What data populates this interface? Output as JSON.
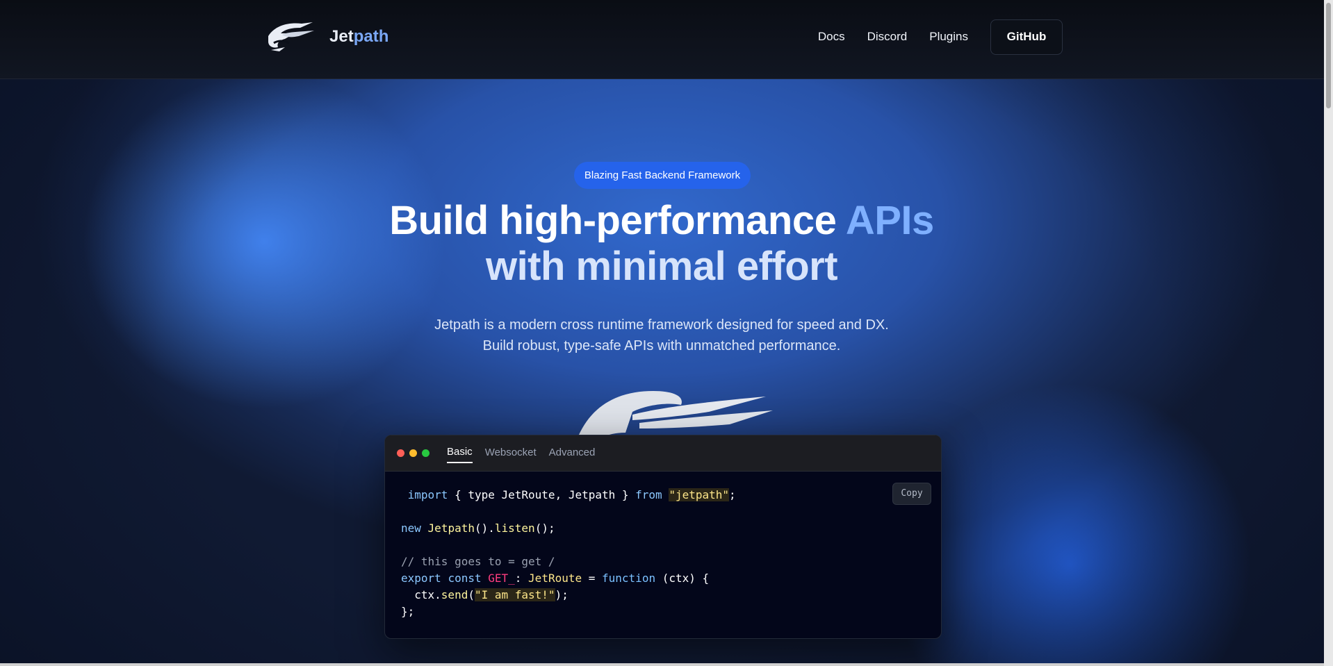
{
  "header": {
    "brand_prefix": "Jet",
    "brand_suffix": "path",
    "logo_icon": "jetpath-bird-logo",
    "nav": [
      {
        "label": "Docs"
      },
      {
        "label": "Discord"
      },
      {
        "label": "Plugins"
      }
    ],
    "github_label": "GitHub"
  },
  "hero": {
    "badge": "Blazing Fast Backend Framework",
    "headline_line1_a": "Build high-performance ",
    "headline_line1_b": "APIs",
    "headline_line2": "with minimal effort",
    "sub_line1": "Jetpath is a modern cross runtime framework designed for speed and DX.",
    "sub_line2": "Build robust, type-safe APIs with unmatched performance."
  },
  "code": {
    "tabs": [
      "Basic",
      "Websocket",
      "Advanced"
    ],
    "active_tab": "Basic",
    "copy_label": "Copy",
    "lines": {
      "l1_import": "import",
      "l1_mid": " { type JetRoute, Jetpath } ",
      "l1_from": "from",
      "l1_str": "\"jetpath\"",
      "l1_end": ";",
      "l3_new": "new",
      "l3_cls": "Jetpath",
      "l3_mid": "().",
      "l3_fn": "listen",
      "l3_end": "();",
      "l5_comment": "// this goes to = get /",
      "l6_export": "export",
      "l6_const": "const",
      "l6_var": "GET_",
      "l6_colon": ": ",
      "l6_type": "JetRoute",
      "l6_eq": " = ",
      "l6_function": "function",
      "l6_end": " (ctx) {",
      "l7_ctx": "  ctx.",
      "l7_fn": "send",
      "l7_open": "(",
      "l7_str": "\"I am fast!\"",
      "l7_end": ");",
      "l8": "};"
    }
  },
  "colors": {
    "badge": "#2563eb",
    "accent": "#7fb0ff",
    "code_bg": "#03061a"
  }
}
